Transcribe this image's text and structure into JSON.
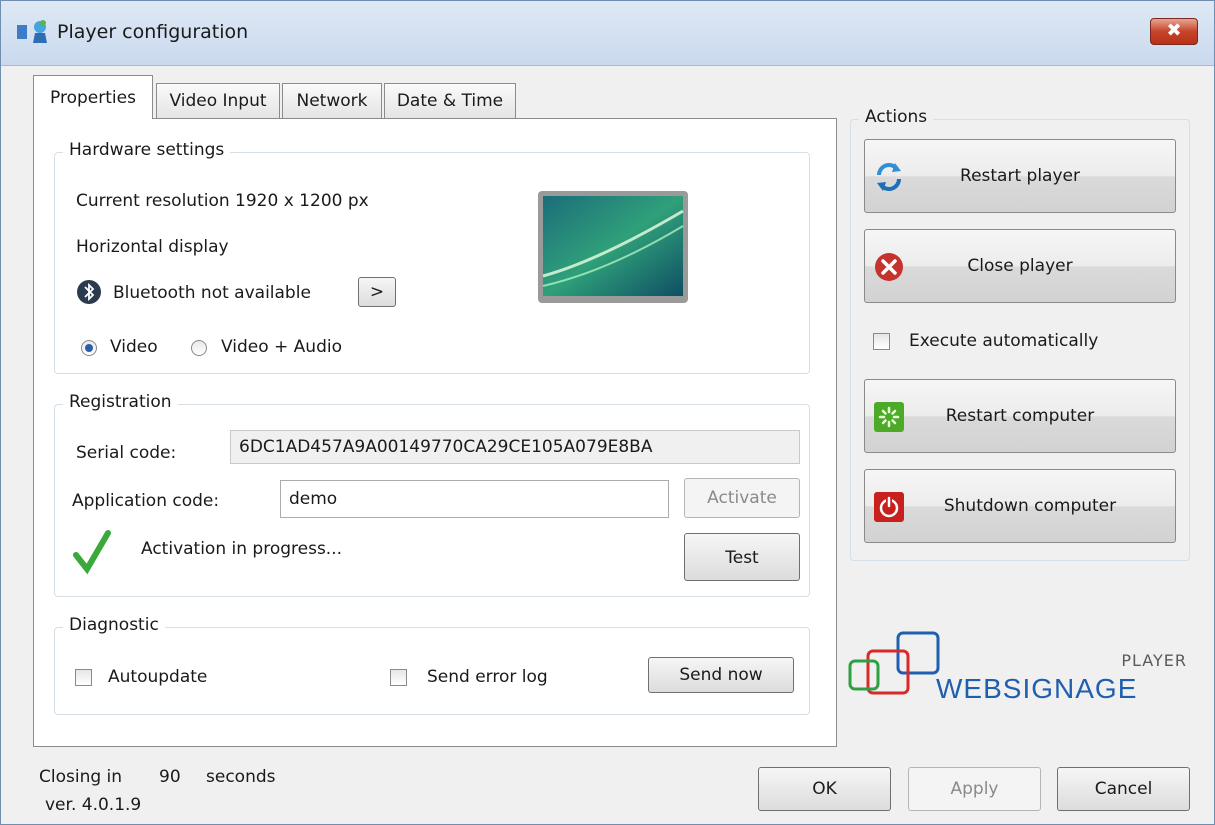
{
  "window": {
    "title": "Player configuration",
    "close_glyph": "✖"
  },
  "tabs": [
    {
      "label": "Properties"
    },
    {
      "label": "Video Input"
    },
    {
      "label": "Network"
    },
    {
      "label": "Date & Time"
    }
  ],
  "hardware": {
    "legend": "Hardware settings",
    "resolution": "Current resolution 1920 x 1200 px",
    "orientation": "Horizontal display",
    "bluetooth": "Bluetooth not available",
    "bluetooth_button": ">",
    "radio_video": "Video",
    "radio_video_audio": "Video + Audio",
    "selected_mode": "Video"
  },
  "registration": {
    "legend": "Registration",
    "serial_label": "Serial code:",
    "serial_value": "6DC1AD457A9A00149770CA29CE105A079E8BA",
    "app_code_label": "Application code:",
    "app_code_value": "demo",
    "activate_label": "Activate",
    "status": "Activation in progress...",
    "test_label": "Test"
  },
  "diagnostic": {
    "legend": "Diagnostic",
    "autoupdate": "Autoupdate",
    "send_error_log": "Send error log",
    "send_now": "Send now"
  },
  "actions": {
    "legend": "Actions",
    "restart_player": "Restart player",
    "close_player": "Close player",
    "execute_auto": "Execute automatically",
    "restart_computer": "Restart computer",
    "shutdown_computer": "Shutdown computer"
  },
  "logo": {
    "top": "PLAYER",
    "brand": "WEBSIGNAGE"
  },
  "footer": {
    "closing_prefix": "Closing in",
    "closing_seconds": "90",
    "closing_suffix": "seconds",
    "version": "ver. 4.0.1.9",
    "ok": "OK",
    "apply": "Apply",
    "cancel": "Cancel"
  },
  "colors": {
    "accent": "#2a5fa8",
    "logo_blue": "#1f5fb0",
    "logo_red": "#d82a2a",
    "logo_green": "#2ea043"
  }
}
